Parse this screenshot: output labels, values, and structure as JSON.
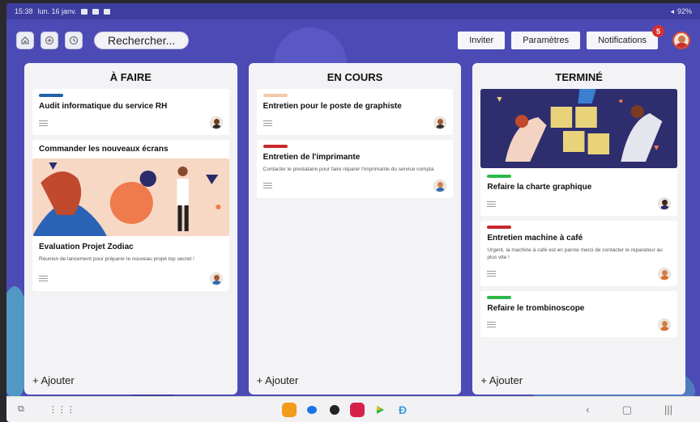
{
  "status_bar": {
    "time": "15:38",
    "date": "lun. 16 janv.",
    "battery": "92%"
  },
  "toolbar": {
    "home_icon": "home-icon",
    "add_icon": "add-circle-icon",
    "history_icon": "clock-icon",
    "search_label": "Rechercher...",
    "invite_label": "Inviter",
    "settings_label": "Paramètres",
    "notifications_label": "Notifications",
    "notifications_count": "5"
  },
  "columns": [
    {
      "title": "À FAIRE",
      "add_label": "+ Ajouter",
      "cards": [
        {
          "title": "Audit informatique du service RH",
          "tag_color": "#1e62a8"
        },
        {
          "title": "Commander les nouveaux écrans"
        },
        {
          "title": "Evaluation Projet Zodiac",
          "description": "Réunion de lancement pour préparer le nouveau projet top secret !"
        }
      ]
    },
    {
      "title": "EN COURS",
      "add_label": "+ Ajouter",
      "cards": [
        {
          "title": "Entretien pour le poste de graphiste",
          "tag_color": "#f2c9a9"
        },
        {
          "title": "Entretien de l'imprimante",
          "description": "Contacter le prestataire pour faire réparer l'imprimante du service compta",
          "tag_color": "#c62828"
        }
      ]
    },
    {
      "title": "TERMINÉ",
      "add_label": "+ Ajouter",
      "cards": [
        {
          "title": "Refaire la charte graphique",
          "tag_color": "#2eb84a"
        },
        {
          "title": "Entretien machine à café",
          "description": "Urgent, la machine à café est en panne merci de contacter le réparateur au plus vite !",
          "tag_color": "#c62828"
        },
        {
          "title": "Refaire le trombinoscope",
          "tag_color": "#2eb84a"
        }
      ]
    }
  ],
  "colors": {
    "background": "#4c4bb5",
    "column": "#f3f3f6",
    "badge": "#d6302e"
  }
}
